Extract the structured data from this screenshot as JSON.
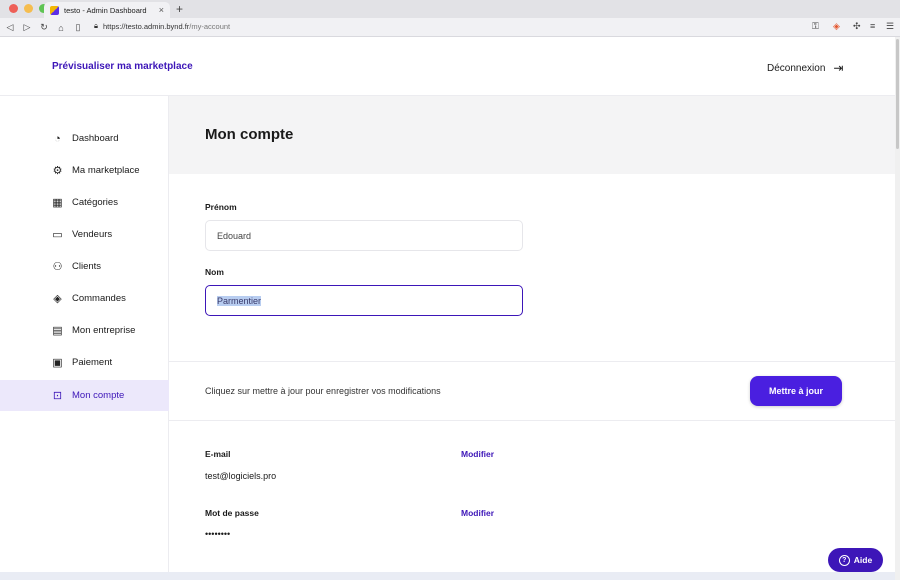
{
  "browser": {
    "tab_title": "testo - Admin Dashboard",
    "new_tab": "+",
    "url_host": "https://testo.admin.bynd.fr",
    "url_path": "/my-account"
  },
  "header": {
    "preview_link": "Prévisualiser ma marketplace",
    "logout": "Déconnexion"
  },
  "sidebar": {
    "items": [
      {
        "label": "Dashboard",
        "icon": "pie-chart-icon"
      },
      {
        "label": "Ma marketplace",
        "icon": "gear-icon"
      },
      {
        "label": "Catégories",
        "icon": "grid-icon"
      },
      {
        "label": "Vendeurs",
        "icon": "briefcase-icon"
      },
      {
        "label": "Clients",
        "icon": "users-icon"
      },
      {
        "label": "Commandes",
        "icon": "layers-icon"
      },
      {
        "label": "Mon entreprise",
        "icon": "store-icon"
      },
      {
        "label": "Paiement",
        "icon": "wallet-icon"
      },
      {
        "label": "Mon compte",
        "icon": "lock-icon"
      }
    ]
  },
  "main": {
    "title": "Mon compte",
    "first_name_label": "Prénom",
    "first_name_value": "Edouard",
    "last_name_label": "Nom",
    "last_name_value": "Parmentier",
    "update_hint": "Cliquez sur mettre à jour pour enregistrer vos modifications",
    "update_button": "Mettre à jour",
    "email_label": "E-mail",
    "email_value": "test@logiciels.pro",
    "email_modify": "Modifier",
    "password_label": "Mot de passe",
    "password_value": "••••••••",
    "password_modify": "Modifier"
  },
  "help": {
    "label": "Aide"
  },
  "colors": {
    "accent": "#3d16b8",
    "button": "#4a1fe0",
    "active_bg": "#ece8fb"
  }
}
